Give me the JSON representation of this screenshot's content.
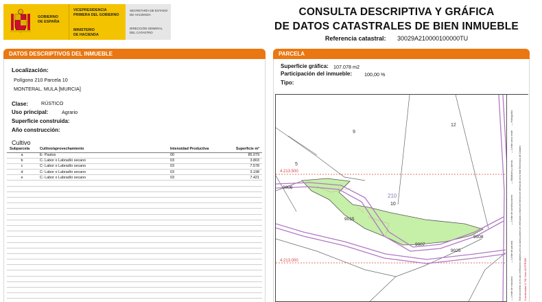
{
  "header": {
    "gov_line1": "GOBIERNO",
    "gov_line2": "DE ESPAÑA",
    "vice_line1": "VICEPRESIDENCIA",
    "vice_line2": "PRIMERA DEL GOBIERNO",
    "min_line1": "MINISTERIO",
    "min_line2": "DE HACIENDA",
    "sec_line1": "SECRETARÍA DE ESTADO",
    "sec_line2": "DE HACIENDA",
    "dir_line1": "DIRECCIÓN GENERAL",
    "dir_line2": "DEL CATASTRO",
    "title_line1": "CONSULTA DESCRIPTIVA Y GRÁFICA",
    "title_line2": "DE DATOS CATASTRALES DE BIEN INMUEBLE",
    "ref_label": "Referencia catastral:",
    "ref_value": "30029A210000100000TU"
  },
  "left": {
    "section_title_prefix": "DATOS DESCRIPTIVOS DEL ",
    "section_title_bold": "INMUEBLE",
    "localizacion_label": "Localización:",
    "localizacion_line1": "Polígono 210 Parcela 10",
    "localizacion_line2": "MONTERAL. MULA [MURCIA]",
    "clase_label": "Clase:",
    "clase_value": "RÚSTICO",
    "uso_label": "Uso principal:",
    "uso_value": "Agrario",
    "superficie_label": "Superficie construida:",
    "anio_label": "Año construcción:",
    "cultivo_title": "Cultivo",
    "table_headers": {
      "subparcela": "Subparcela",
      "cultivo": "Cultivo/aprovechamiento",
      "intensidad": "Intensidad Productiva",
      "superficie": "Superficie m²"
    },
    "rows": [
      {
        "sub": "a",
        "cultivo": "E- Pastos",
        "int": "00",
        "sup": "85.079"
      },
      {
        "sub": "b",
        "cultivo": "C- Labor o Labradío secano",
        "int": "03",
        "sup": "3.803"
      },
      {
        "sub": "c",
        "cultivo": "C- Labor o Labradío secano",
        "int": "03",
        "sup": "7.578"
      },
      {
        "sub": "d",
        "cultivo": "C- Labor o Labradío secano",
        "int": "03",
        "sup": "3.198"
      },
      {
        "sub": "e",
        "cultivo": "C- Labor o Labradío secano",
        "int": "03",
        "sup": "7.421"
      }
    ]
  },
  "right": {
    "section_title": "PARCELA",
    "sup_grafica_label": "Superficie gráfica:",
    "sup_grafica_value": "107.078 m2",
    "participacion_label": "Participación del inmueble:",
    "participacion_value": "100,00 %",
    "tipo_label": "Tipo:"
  },
  "map": {
    "labels": {
      "p9": "9",
      "p12": "12",
      "p5": "5",
      "p210": "210",
      "p10": "10",
      "p9006": "9006",
      "p9015": "9015",
      "p9007": "9007",
      "p9008": "9008",
      "p9025": "9025",
      "y1": "4.213.500",
      "y2": "4.213.000"
    },
    "colors": {
      "parcel_fill": "#c6efa8",
      "parcel_stroke": "#555555",
      "road": "#b277c4",
      "grid": "#d94040"
    },
    "legend_lines": [
      "— Límite de manzana",
      "— Límite de parcela",
      "— Límite de construcciones",
      "— Mobiliario y aceras",
      "— Límite zona verde",
      "— Hidrografía"
    ],
    "legend_note": "Este documento no es una certificación catastral, pero sus datos pueden ser verificados a través del Servicio de verificación de la Sede Electrónica del Catastro",
    "legend_coords": "Coordenadas U.T.M. Huso 30 ETRS89"
  }
}
